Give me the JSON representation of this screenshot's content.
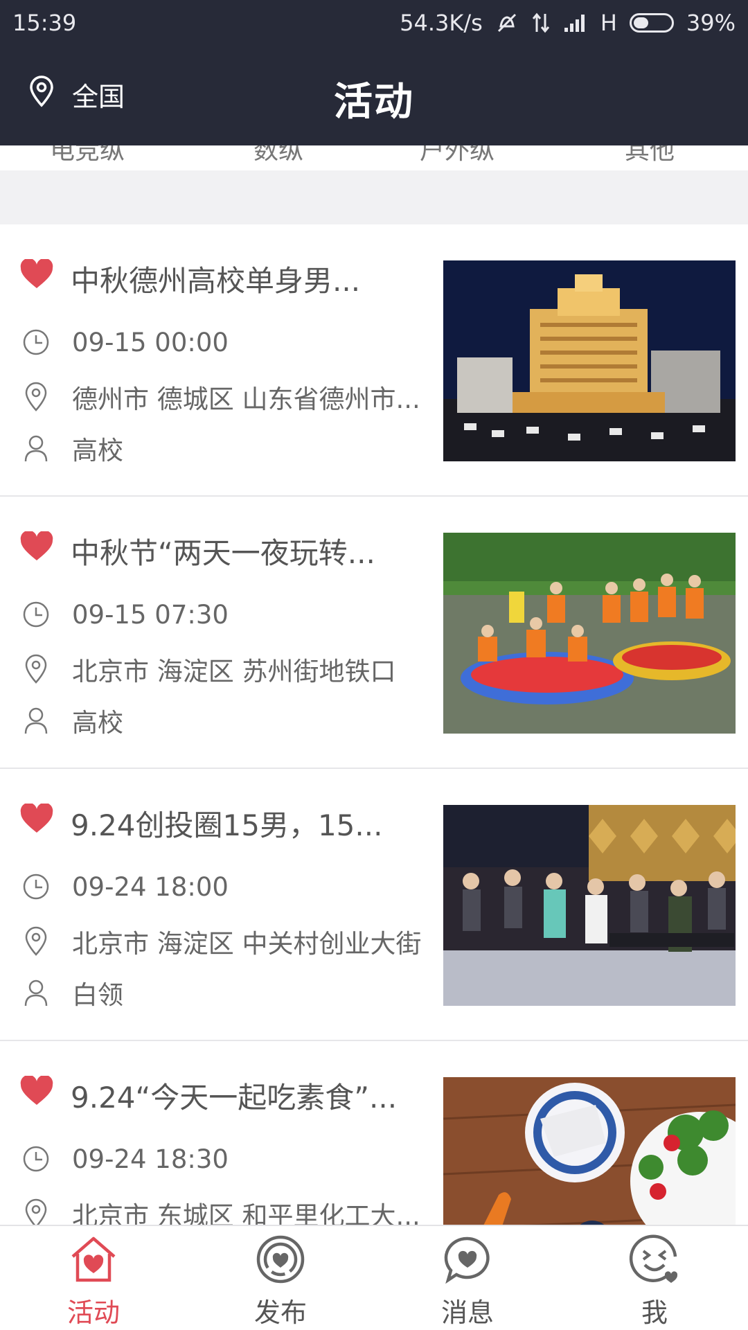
{
  "status_bar": {
    "time": "15:39",
    "network_speed": "54.3K/s",
    "signal_type": "H",
    "battery": "39%"
  },
  "header": {
    "location_label": "全国",
    "title": "活动"
  },
  "categories": [
    "电竞纵",
    "数纵",
    "户外纵",
    "其他"
  ],
  "events": [
    {
      "title": "中秋德州高校单身男...",
      "time": "09-15 00:00",
      "place": "德州市 德城区 山东省德州市...",
      "crowd": "高校",
      "image": "hotel-night-photo"
    },
    {
      "title": "中秋节“两天一夜玩转...",
      "time": "09-15 07:30",
      "place": "北京市 海淀区 苏州街地铁口",
      "crowd": "高校",
      "image": "rafting-group-photo"
    },
    {
      "title": "9.24创投圈15男，15...",
      "time": "09-24 18:00",
      "place": "北京市 海淀区 中关村创业大街",
      "crowd": "白领",
      "image": "party-dinner-photo"
    },
    {
      "title": "9.24“今天一起吃素食”...",
      "time": "09-24 18:30",
      "place": "北京市 东城区 和平里化工大...",
      "crowd": "",
      "image": "vegetarian-food-photo"
    }
  ],
  "tabs": [
    {
      "label": "活动",
      "icon": "house-heart-icon",
      "active": true
    },
    {
      "label": "发布",
      "icon": "target-heart-icon",
      "active": false
    },
    {
      "label": "消息",
      "icon": "chat-heart-icon",
      "active": false
    },
    {
      "label": "我",
      "icon": "smiley-heart-icon",
      "active": false
    }
  ],
  "colors": {
    "header_bg": "#272a38",
    "accent": "#e04a55",
    "text_gray": "#666666"
  }
}
